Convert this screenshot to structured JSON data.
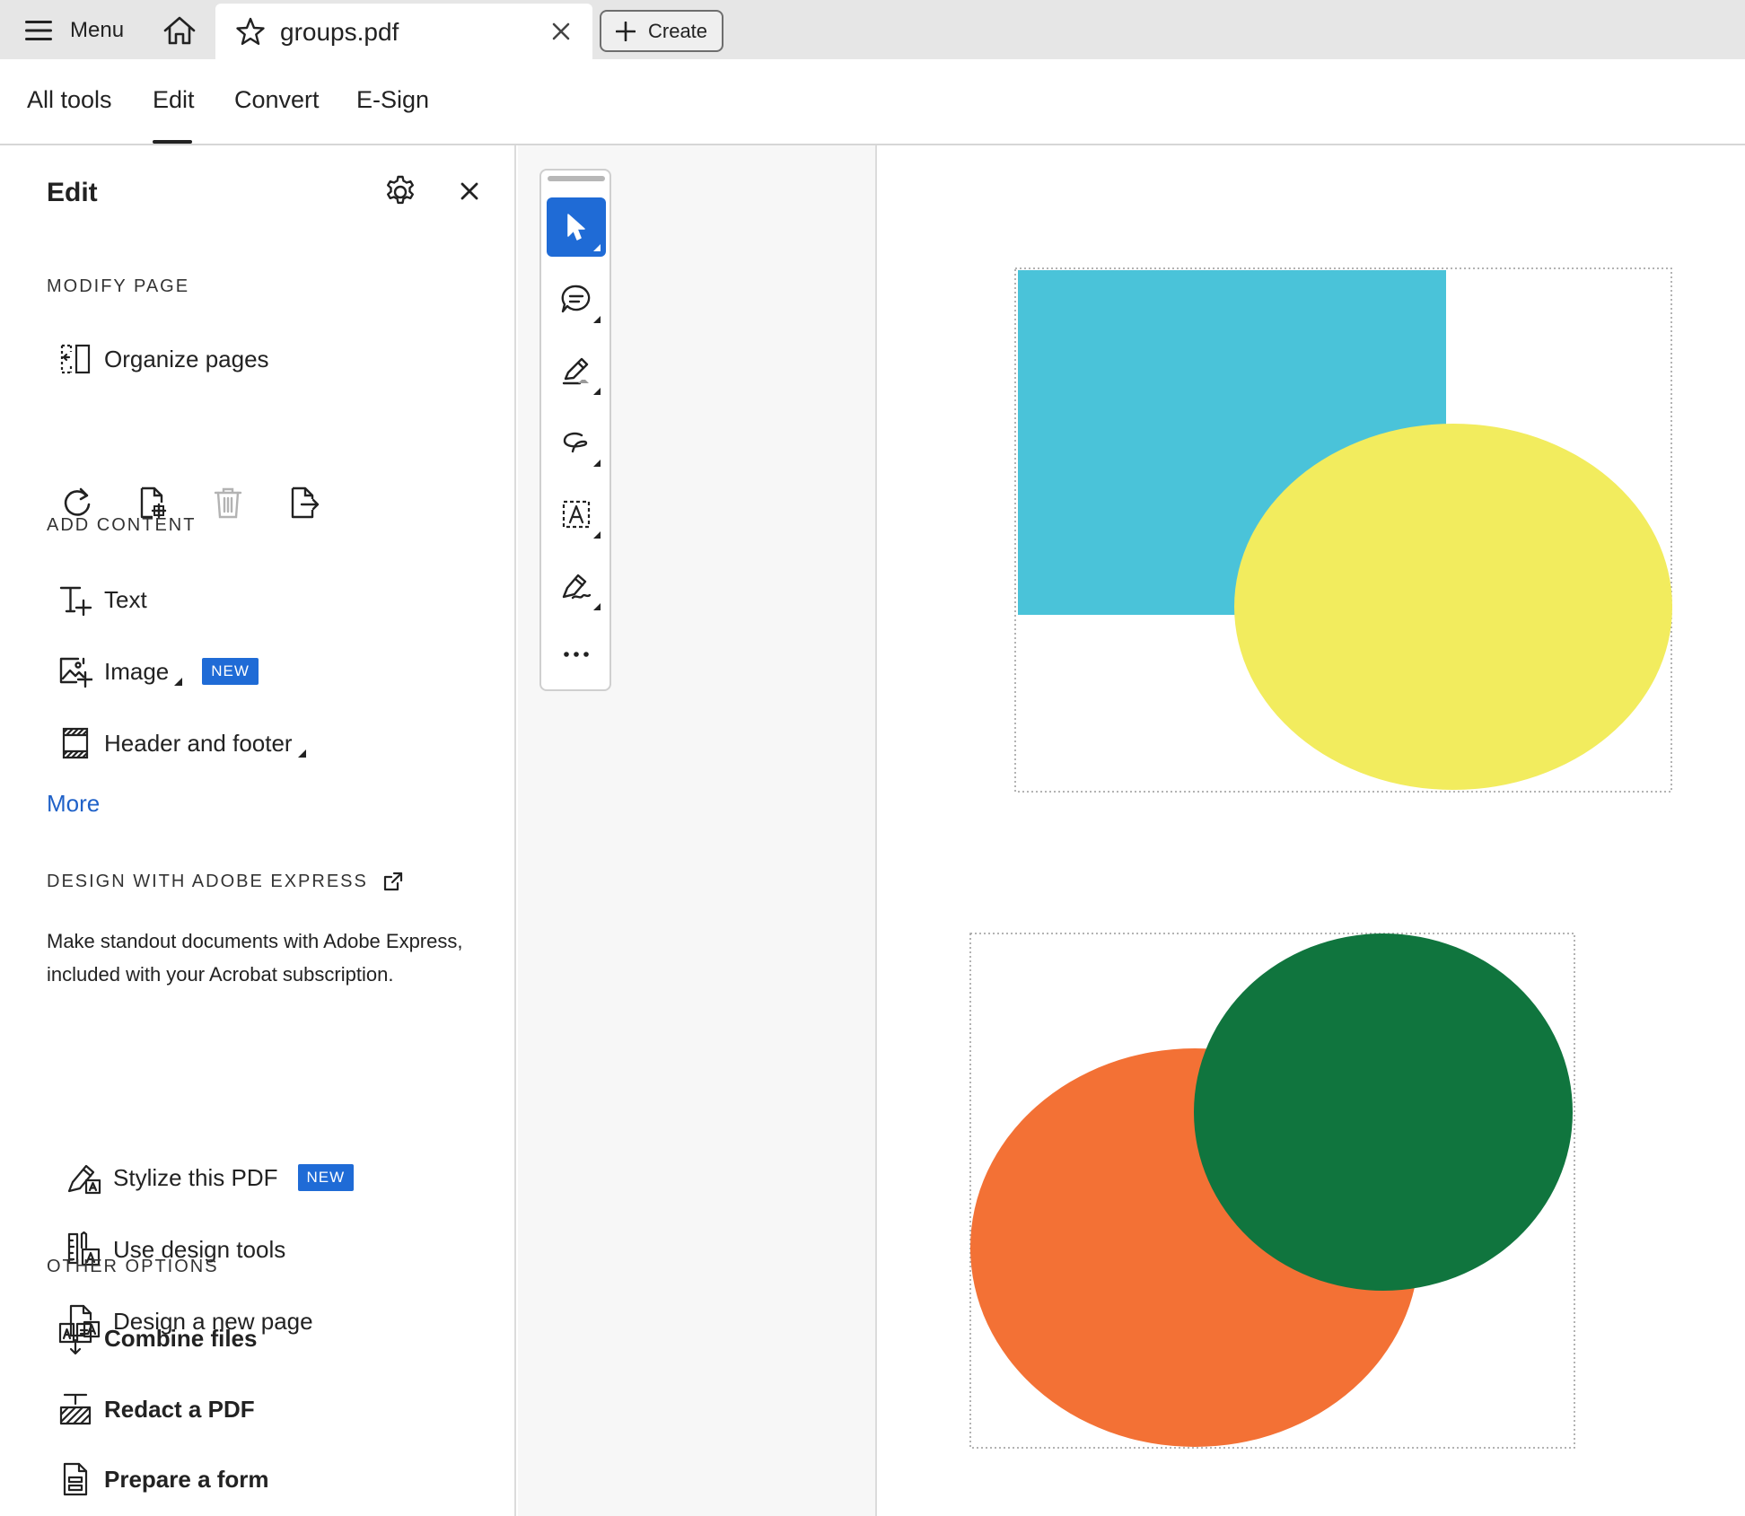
{
  "topbar": {
    "menu_label": "Menu",
    "tab_title": "groups.pdf",
    "create_label": "Create"
  },
  "nav": {
    "items": [
      {
        "label": "All tools"
      },
      {
        "label": "Edit",
        "active": true
      },
      {
        "label": "Convert"
      },
      {
        "label": "E-Sign"
      }
    ]
  },
  "panel": {
    "title": "Edit",
    "sections": {
      "modify_page": {
        "heading": "MODIFY PAGE",
        "icons": [
          "rotate-icon",
          "insert-page-icon",
          "delete-icon",
          "extract-page-icon"
        ],
        "organize_label": "Organize pages"
      },
      "add_content": {
        "heading": "ADD CONTENT",
        "text_label": "Text",
        "image_label": "Image",
        "image_badge": "NEW",
        "header_footer_label": "Header and footer",
        "more_label": "More"
      },
      "design": {
        "heading": "DESIGN WITH ADOBE EXPRESS",
        "description": "Make standout documents with Adobe Express, included with your Acrobat subscription.",
        "stylize_label": "Stylize this PDF",
        "stylize_badge": "NEW",
        "design_tools_label": "Use design tools",
        "new_page_label": "Design a new page"
      },
      "other": {
        "heading": "OTHER OPTIONS",
        "combine_label": "Combine files",
        "redact_label": "Redact a PDF",
        "prepare_label": "Prepare a form"
      }
    }
  },
  "toolbar": {
    "tools": [
      "select-icon",
      "comment-icon",
      "highlight-icon",
      "draw-icon",
      "text-recognize-icon",
      "sign-icon",
      "more-icon"
    ],
    "active_tool": "select-icon"
  },
  "colors": {
    "accent": "#1f6bd6",
    "rect_blue": "#4ac3d9",
    "ellipse_yellow": "#f2ec5e",
    "ellipse_orange": "#f37135",
    "ellipse_green": "#10753e"
  }
}
